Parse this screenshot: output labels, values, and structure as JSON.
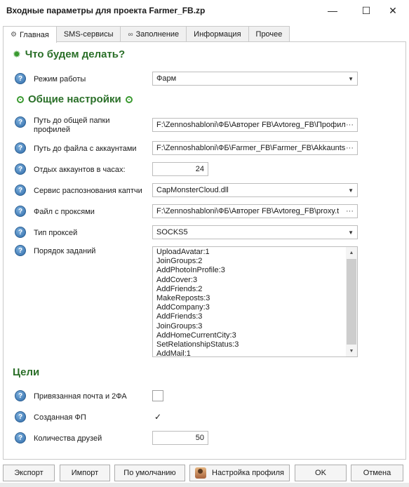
{
  "window": {
    "title": "Входные параметры для проекта Farmer_FB.zp"
  },
  "tabs": [
    {
      "label": "Главная",
      "icon": "gear-icon",
      "active": true
    },
    {
      "label": "SMS-сервисы",
      "icon": "",
      "active": false
    },
    {
      "label": "Заполнение",
      "icon": "infinity-icon",
      "active": false
    },
    {
      "label": "Информация",
      "icon": "",
      "active": false
    },
    {
      "label": "Прочее",
      "icon": "",
      "active": false
    }
  ],
  "sections": {
    "what": "Что будем делать?",
    "general": "Общие настройки",
    "goals": "Цели"
  },
  "fields": {
    "mode": {
      "label": "Режим работы",
      "value": "Фарм"
    },
    "shared_folder": {
      "label": "Путь до общей папки профилей",
      "value": "F:\\Zennoshabloni\\ФБ\\Авторег FB\\Avtoreg_FB\\Профил"
    },
    "accounts_file": {
      "label": "Путь до файла с аккаунтами",
      "value": "F:\\Zennoshabloni\\ФБ\\Farmer_FB\\Farmer_FB\\Akkaunts\\"
    },
    "rest_hours": {
      "label": "Отдых аккаунтов в часах:",
      "value": "24"
    },
    "captcha": {
      "label": "Сервис распознования каптчи",
      "value": "CapMonsterCloud.dll"
    },
    "proxy_file": {
      "label": "Файл с проксями",
      "value": "F:\\Zennoshabloni\\ФБ\\Авторег FB\\Avtoreg_FB\\proxy.t"
    },
    "proxy_type": {
      "label": "Тип проксей",
      "value": "SOCKS5"
    },
    "task_order": {
      "label": "Порядок заданий",
      "items": [
        "UploadAvatar:1",
        "JoinGroups:2",
        "AddPhotoInProfile:3",
        "AddCover:3",
        "AddFriends:2",
        "MakeReposts:3",
        "AddCompany:3",
        "AddFriends:3",
        "JoinGroups:3",
        "AddHomeCurrentCity:3",
        "SetRelationshipStatus:3",
        "AddMail:1"
      ]
    },
    "linked_mail": {
      "label": "Привязанная почта и 2ФА",
      "checked": false
    },
    "created_fp": {
      "label": "Созданная ФП",
      "checked": true
    },
    "friends_count": {
      "label": "Количества друзей",
      "value": "50"
    }
  },
  "buttons": {
    "export": "Экспорт",
    "import": "Импорт",
    "defaults": "По умолчанию",
    "profile_settings": "Настройка профиля",
    "ok": "OK",
    "cancel": "Отмена"
  },
  "colors": {
    "section": "#2a6f28",
    "accent": "#3a9a30",
    "help": "#2d6aa8"
  }
}
